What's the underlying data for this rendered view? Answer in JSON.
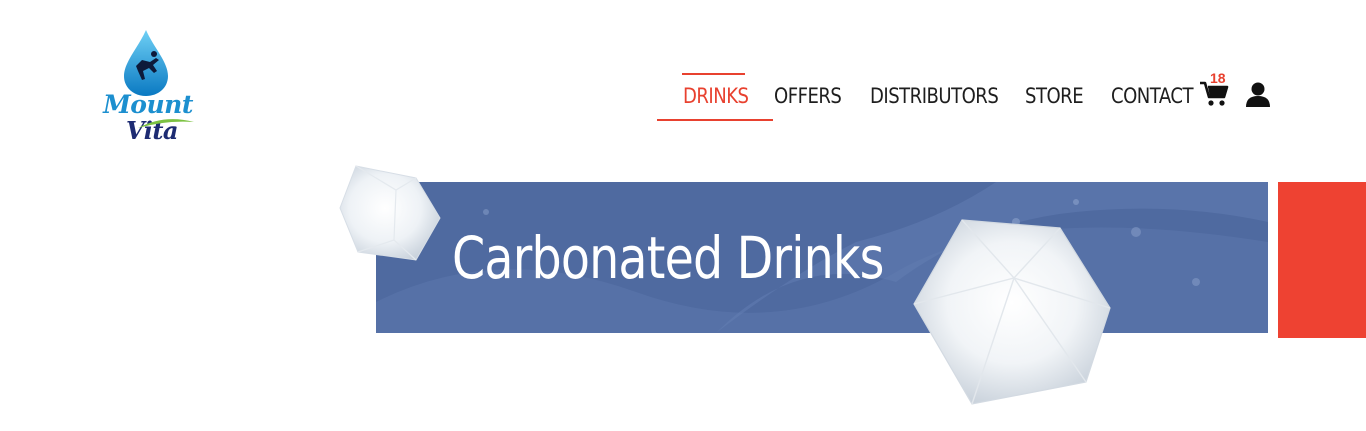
{
  "logo": {
    "line1": "Mount",
    "line2": "Vita"
  },
  "nav": {
    "items": [
      {
        "label": "DRINKS",
        "active": true
      },
      {
        "label": "OFFERS",
        "active": false
      },
      {
        "label": "DISTRIBUTORS",
        "active": false
      },
      {
        "label": "STORE",
        "active": false
      },
      {
        "label": "CONTACT",
        "active": false
      }
    ],
    "cart_count": "18",
    "cart_icon": "cart-icon",
    "user_icon": "user-icon"
  },
  "hero": {
    "title": "Carbonated Drinks"
  },
  "colors": {
    "accent": "#e8412f",
    "banner": "#4f6aa0",
    "brand_blue": "#1c8fcf"
  }
}
